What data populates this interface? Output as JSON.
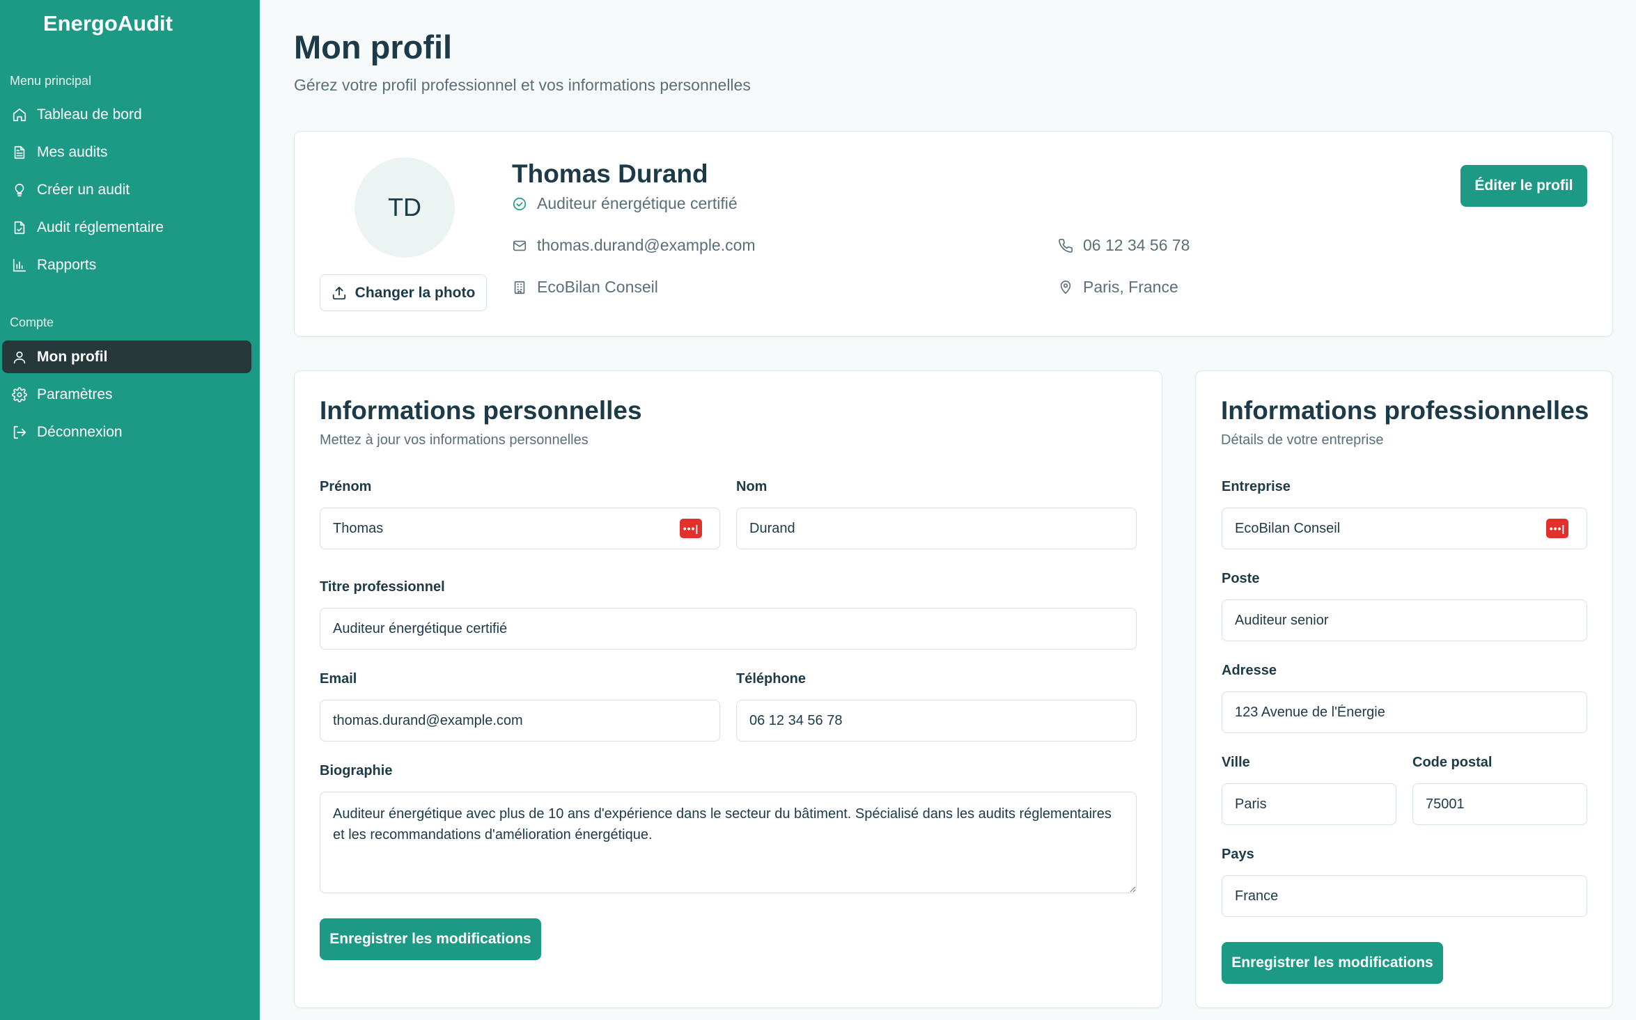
{
  "app": {
    "brand": "EnergoAudit"
  },
  "sidebar": {
    "main_label": "Menu principal",
    "main_items": [
      {
        "label": "Tableau de bord",
        "icon": "home-icon"
      },
      {
        "label": "Mes audits",
        "icon": "file-icon"
      },
      {
        "label": "Créer un audit",
        "icon": "lightbulb-icon"
      },
      {
        "label": "Audit réglementaire",
        "icon": "file-check-icon"
      },
      {
        "label": "Rapports",
        "icon": "bar-chart-icon"
      }
    ],
    "account_label": "Compte",
    "account_items": [
      {
        "label": "Mon profil",
        "icon": "user-icon",
        "active": true
      },
      {
        "label": "Paramètres",
        "icon": "gear-icon"
      },
      {
        "label": "Déconnexion",
        "icon": "logout-icon"
      }
    ]
  },
  "header": {
    "title": "Mon profil",
    "subtitle": "Gérez votre profil professionnel et vos informations personnelles"
  },
  "profile": {
    "initials": "TD",
    "change_photo": "Changer la photo",
    "name": "Thomas Durand",
    "title": "Auditeur énergétique certifié",
    "email": "thomas.durand@example.com",
    "phone": "06 12 34 56 78",
    "company": "EcoBilan Conseil",
    "location": "Paris, France",
    "edit_button": "Éditer le profil"
  },
  "personal": {
    "title": "Informations personnelles",
    "description": "Mettez à jour vos informations personnelles",
    "first_name_label": "Prénom",
    "first_name": "Thomas",
    "last_name_label": "Nom",
    "last_name": "Durand",
    "job_title_label": "Titre professionnel",
    "job_title": "Auditeur énergétique certifié",
    "email_label": "Email",
    "email": "thomas.durand@example.com",
    "phone_label": "Téléphone",
    "phone": "06 12 34 56 78",
    "bio_label": "Biographie",
    "bio": "Auditeur énergétique avec plus de 10 ans d'expérience dans le secteur du bâtiment. Spécialisé dans les audits réglementaires et les recommandations d'amélioration énergétique.",
    "save_button": "Enregistrer les modifications"
  },
  "professional": {
    "title": "Informations professionnelles",
    "description": "Détails de votre entreprise",
    "company_label": "Entreprise",
    "company": "EcoBilan Conseil",
    "position_label": "Poste",
    "position": "Auditeur senior",
    "address_label": "Adresse",
    "address": "123 Avenue de l'Énergie",
    "city_label": "Ville",
    "city": "Paris",
    "postal_label": "Code postal",
    "postal": "75001",
    "country_label": "Pays",
    "country": "France",
    "save_button": "Enregistrer les modifications"
  },
  "colors": {
    "primary": "#1d9a85",
    "active_nav": "#25393b",
    "text": "#1c3a47",
    "muted": "#5a6f78",
    "password_badge": "#e0312c"
  }
}
